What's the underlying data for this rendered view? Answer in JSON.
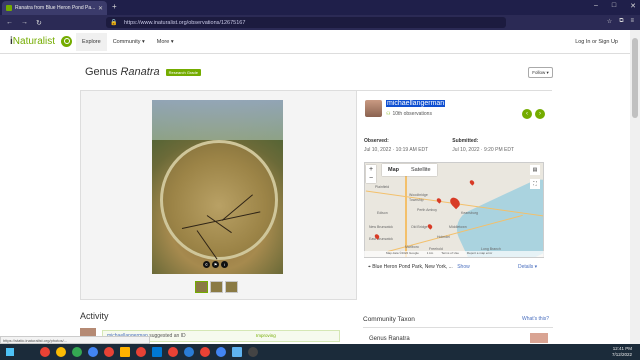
{
  "browser": {
    "tab_title": "Ranatra from Blue Heron Pond Pa...",
    "url": "https://www.inaturalist.org/observations/12675167"
  },
  "header": {
    "logo_i": "i",
    "logo_rest": "Naturalist",
    "nav": [
      "Explore",
      "Community ▾",
      "More ▾"
    ],
    "login": "Log In or Sign Up"
  },
  "observation": {
    "title_prefix": "Genus",
    "title_taxon": "Ranatra",
    "grade_badge": "Research Grade",
    "follow_label": "Follow ▾"
  },
  "observer": {
    "username": "michaellangerman",
    "obs_count": "10th observations"
  },
  "dates": {
    "observed_label": "Observed:",
    "observed_value": "Jul 10, 2022 · 10:19 AM EDT",
    "submitted_label": "Submitted:",
    "submitted_value": "Jul 10, 2022 · 9:20 PM EDT"
  },
  "map": {
    "tab_map": "Map",
    "tab_satellite": "Satellite",
    "towns": [
      "Woodbridge",
      "Township",
      "Edison",
      "Perth Amboy",
      "Old Bridge",
      "Keansburg",
      "Middletown",
      "Holmdel",
      "Freehold",
      "Long Branch",
      "East Brunswick",
      "New Brunswick",
      "Marlboro",
      "Plainfield"
    ],
    "footer": [
      "Map data ©2022 Google",
      "1 km",
      "Terms of Use",
      "Report a map error"
    ]
  },
  "location": {
    "place": "Blue Heron Pond Park, New York, ...",
    "show": "Show",
    "details": "Details ▾"
  },
  "activity": {
    "heading": "Activity",
    "entry_user": "michaellangerman",
    "entry_text": "suggested an ID",
    "improving": "Improving"
  },
  "community": {
    "heading": "Community Taxon",
    "whats_this": "What's this?",
    "taxon": "Genus Ranatra"
  },
  "status_url": "https://static.inaturalist.org/photos/...",
  "tray": {
    "time": "12:41 PM",
    "date": "7/12/2022"
  },
  "colors": {
    "brand": "#74ac00",
    "link": "#4a6fbf",
    "highlight": "#0f4fd1"
  }
}
